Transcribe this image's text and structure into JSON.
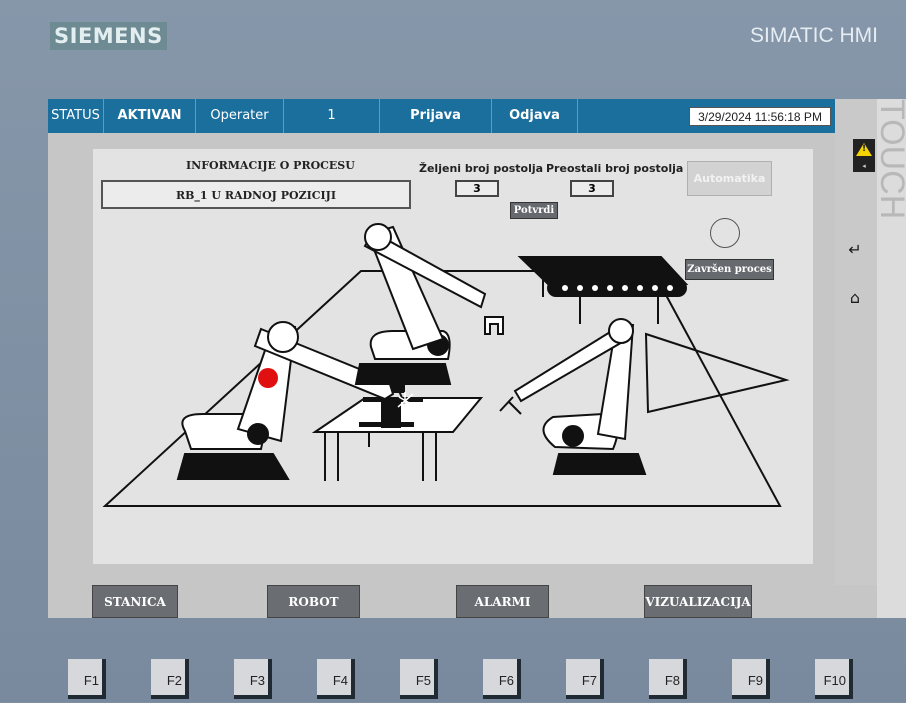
{
  "brand": "SIEMENS",
  "model": "SIMATIC HMI",
  "side_label": "TOUCH",
  "topbar": {
    "status_label": "STATUS",
    "status_value": "AKTIVAN",
    "user_label": "Operater",
    "user_value": "1",
    "login": "Prijava",
    "logout": "Odjava",
    "datetime": "3/29/2024 11:56:18 PM"
  },
  "process": {
    "info_title": "INFORMACIJE O PROCESU",
    "status_message": "RB_1 U RADNOJ POZICIJI",
    "desired_label": "Željeni broj postolja",
    "desired_value": "3",
    "remaining_label": "Preostali broj postolja",
    "remaining_value": "3",
    "confirm_button": "Potvrdi",
    "auto_button": "Automatika",
    "done_button": "Završen proces"
  },
  "nav": {
    "station": "STANICA",
    "robot": "ROBOT",
    "alarms": "ALARMI",
    "visualization": "VIZUALIZACIJA"
  },
  "fkeys": [
    "F1",
    "F2",
    "F3",
    "F4",
    "F5",
    "F6",
    "F7",
    "F8",
    "F9",
    "F10"
  ],
  "colors": {
    "header_blue": "#1b6f9d",
    "indicator_red": "#e01010",
    "button_gray": "#6a6e73"
  },
  "icons": {
    "alarm": "warning-triangle-icon",
    "enter": "enter-arrow-icon",
    "home": "home-icon"
  }
}
